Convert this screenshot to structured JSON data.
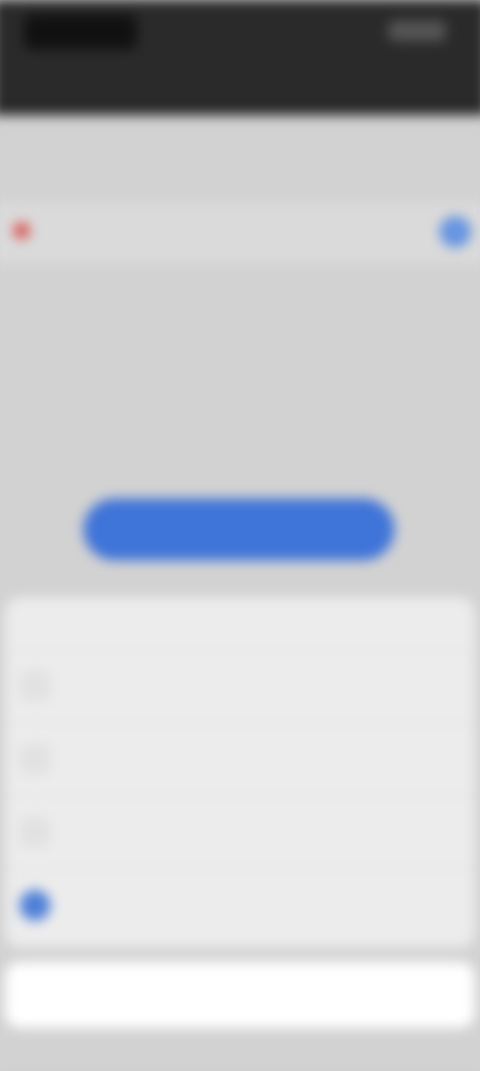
{
  "status_bar": {
    "time": "",
    "indicators": ""
  },
  "nav": {
    "title": ""
  },
  "content": {
    "section_label": "",
    "input_value": "",
    "info_icon": "i",
    "section_label_2": "",
    "link_text": "",
    "glyph": "",
    "primary_button_label": ""
  },
  "sheet": {
    "title": "",
    "items": [
      {
        "label": "",
        "icon": "item-icon"
      },
      {
        "label": "",
        "icon": "item-icon"
      },
      {
        "label": "",
        "icon": "item-icon"
      },
      {
        "label": "",
        "icon": "item-icon-blue"
      }
    ],
    "cancel_label": ""
  },
  "colors": {
    "accent": "#3f74d8",
    "error": "#d9534f",
    "topbar": "#2a2a2a"
  }
}
